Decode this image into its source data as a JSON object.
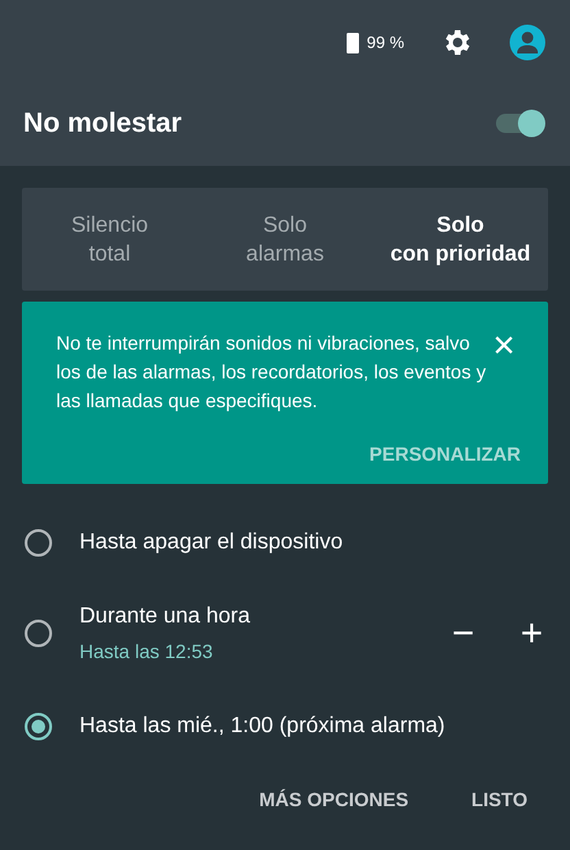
{
  "status_bar": {
    "battery": "99 %"
  },
  "header": {
    "title": "No molestar",
    "on": true
  },
  "tabs": [
    {
      "label": "Silencio\ntotal",
      "selected": false
    },
    {
      "label": "Solo\nalarmas",
      "selected": false
    },
    {
      "label": "Solo\ncon prioridad",
      "selected": true
    }
  ],
  "info_card": {
    "message": "No te interrumpirán sonidos ni vibraciones, salvo los de las alarmas, los recordatorios, los eventos y las llamadas que especifiques.",
    "close": "×",
    "action": "PERSONALIZAR"
  },
  "options": [
    {
      "label": "Hasta apagar el dispositivo",
      "selected": false
    },
    {
      "label": "Durante una hora",
      "subtitle": "Hasta las 12:53",
      "decrease": "−",
      "increase": "+",
      "selected": false
    },
    {
      "label": "Hasta las mié., 1:00 (próxima alarma)",
      "selected": true
    }
  ],
  "buttons": [
    "MÁS OPCIONES",
    "LISTO"
  ]
}
